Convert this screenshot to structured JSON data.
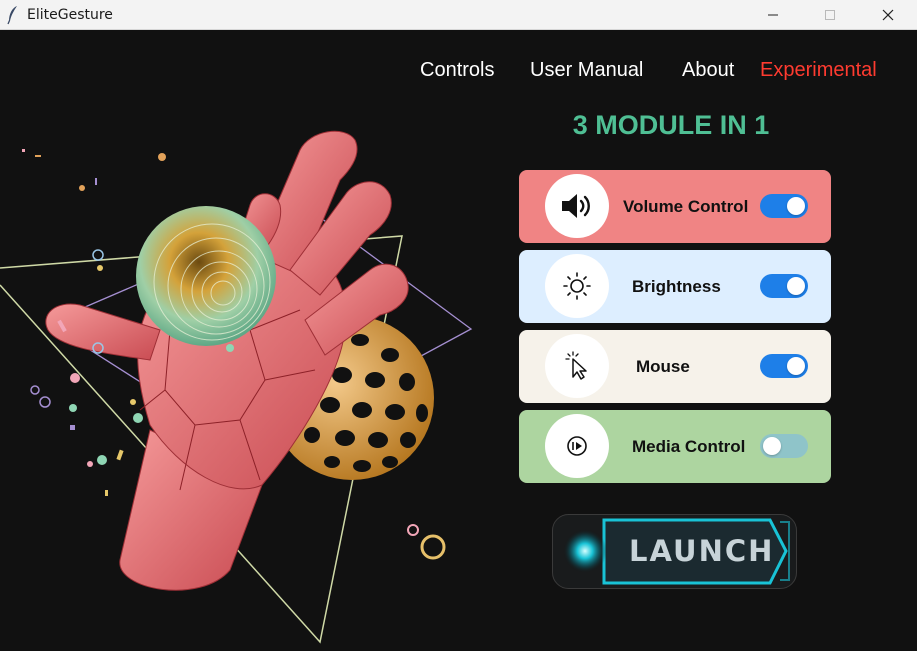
{
  "window": {
    "title": "EliteGesture",
    "controls": [
      "minimize-icon",
      "maximize-icon",
      "close-icon"
    ]
  },
  "nav": {
    "items": [
      {
        "label": "Controls"
      },
      {
        "label": "User Manual"
      },
      {
        "label": "About"
      },
      {
        "label": "Experimental",
        "color": "#ff3b30"
      }
    ]
  },
  "heading": {
    "text": "3 MODULE IN 1",
    "color": "#4fbf94"
  },
  "modules": [
    {
      "label": "Volume Control",
      "icon": "speaker-icon",
      "bg": "#f08484",
      "enabled": true
    },
    {
      "label": "Brightness",
      "icon": "sun-icon",
      "bg": "#ddeeff",
      "enabled": true
    },
    {
      "label": "Mouse",
      "icon": "cursor-click-icon",
      "bg": "#f6f2ea",
      "enabled": true
    },
    {
      "label": "Media Control",
      "icon": "media-play-icon",
      "bg": "#add5a0",
      "enabled": false
    }
  ],
  "toggle_colors": {
    "on": "#1e7fe8",
    "off": "#8fc4c9"
  },
  "launch": {
    "label": "LAUNCH",
    "accent": "#19c3d6"
  }
}
